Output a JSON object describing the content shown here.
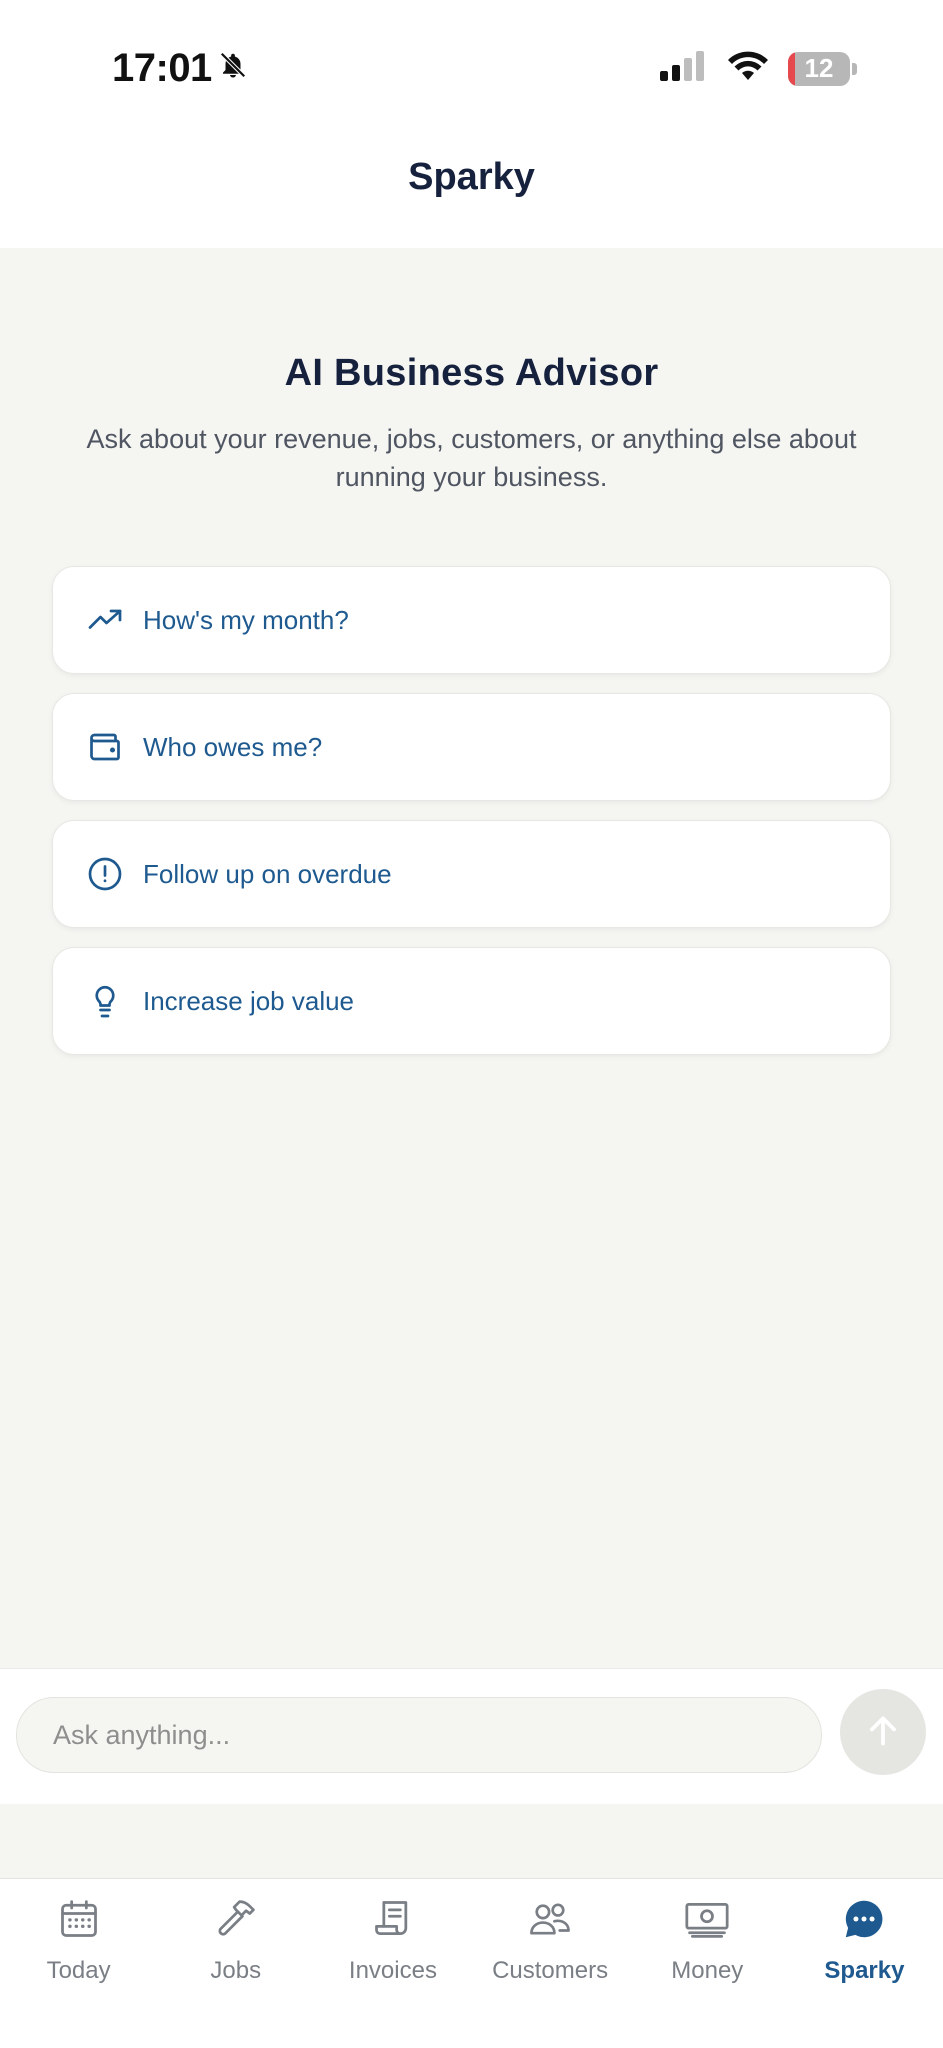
{
  "status_bar": {
    "time": "17:01",
    "battery_level": "12",
    "battery_fraction": 0.12,
    "icons": [
      "bell-slash-icon",
      "cellular-signal-icon",
      "wifi-icon",
      "battery-icon"
    ]
  },
  "header": {
    "title": "Sparky"
  },
  "hero": {
    "title": "AI Business Advisor",
    "subtitle": "Ask about your revenue, jobs, customers, or anything else about running your business."
  },
  "suggestions": [
    {
      "label": "How's my month?",
      "icon": "trending-up-icon"
    },
    {
      "label": "Who owes me?",
      "icon": "wallet-icon"
    },
    {
      "label": "Follow up on overdue",
      "icon": "alert-circle-icon"
    },
    {
      "label": "Increase job value",
      "icon": "lightbulb-icon"
    }
  ],
  "composer": {
    "placeholder": "Ask anything...",
    "value": "",
    "send_icon": "arrow-up-icon"
  },
  "tabs": [
    {
      "label": "Today",
      "icon": "calendar-icon",
      "active": false
    },
    {
      "label": "Jobs",
      "icon": "hammer-icon",
      "active": false
    },
    {
      "label": "Invoices",
      "icon": "receipt-icon",
      "active": false
    },
    {
      "label": "Customers",
      "icon": "users-icon",
      "active": false
    },
    {
      "label": "Money",
      "icon": "banknote-icon",
      "active": false
    },
    {
      "label": "Sparky",
      "icon": "chat-bubble-icon",
      "active": true
    }
  ],
  "colors": {
    "accent": "#1e5a8f",
    "text_dark": "#16213e",
    "background": "#f5f5f2",
    "battery_low": "#e5484d"
  }
}
